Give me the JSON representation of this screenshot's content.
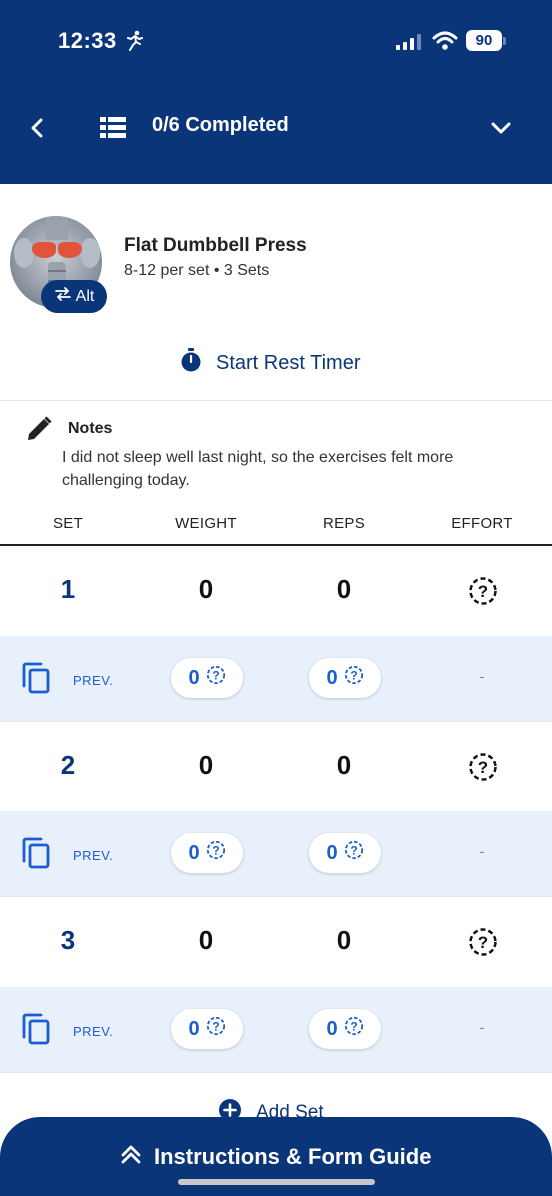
{
  "status_bar": {
    "time": "12:33",
    "battery": "90"
  },
  "nav": {
    "title": "0/6 Completed"
  },
  "exercise": {
    "name": "Flat Dumbbell Press",
    "subtitle": "8-12 per set • 3 Sets",
    "alt_label": "Alt",
    "rest_timer_label": "Start Rest Timer"
  },
  "notes": {
    "title": "Notes",
    "text": "I did not sleep well last night, so the exercises felt more challenging today."
  },
  "table": {
    "headers": [
      "SET",
      "WEIGHT",
      "REPS",
      "EFFORT"
    ],
    "sets": [
      {
        "set": "1",
        "weight": "0",
        "reps": "0",
        "prev_label": "PREV.",
        "prev_weight": "0",
        "prev_reps": "0",
        "prev_effort": "-"
      },
      {
        "set": "2",
        "weight": "0",
        "reps": "0",
        "prev_label": "PREV.",
        "prev_weight": "0",
        "prev_reps": "0",
        "prev_effort": "-"
      },
      {
        "set": "3",
        "weight": "0",
        "reps": "0",
        "prev_label": "PREV.",
        "prev_weight": "0",
        "prev_reps": "0",
        "prev_effort": "-"
      }
    ]
  },
  "add_set_label": "Add Set",
  "guide_label": "Instructions & Form Guide",
  "colors": {
    "brand": "#0b3579",
    "accent": "#1a5fd0",
    "prev_row_bg": "#e8f0fc"
  },
  "icons": [
    "running-icon",
    "signal-icon",
    "wifi-icon",
    "back-chevron-icon",
    "list-icon",
    "chevron-down-icon",
    "swap-icon",
    "stopwatch-icon",
    "pencil-icon",
    "effort-question-icon",
    "copy-icon",
    "add-circle-icon",
    "double-chevron-up-icon"
  ]
}
